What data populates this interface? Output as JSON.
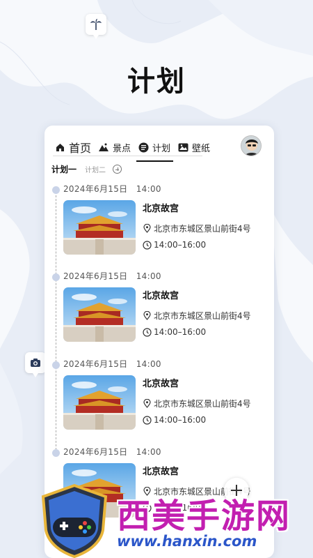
{
  "page": {
    "title": "计划"
  },
  "nav": {
    "tabs": [
      {
        "label": "首页",
        "icon": "home-icon"
      },
      {
        "label": "景点",
        "icon": "mountain-icon"
      },
      {
        "label": "计划",
        "icon": "plan-icon",
        "active": true
      },
      {
        "label": "壁纸",
        "icon": "wallpaper-icon"
      }
    ]
  },
  "plan_tabs": {
    "plan1": "计划一",
    "plan2": "计划二"
  },
  "entries": [
    {
      "datetime": "2024年6月15日　14:00",
      "place": "北京故宫",
      "address": "北京市东城区景山前街4号",
      "time": "14:00–16:00"
    },
    {
      "datetime": "2024年6月15日　14:00",
      "place": "北京故宫",
      "address": "北京市东城区景山前街4号",
      "time": "14:00–16:00"
    },
    {
      "datetime": "2024年6月15日　14:00",
      "place": "北京故宫",
      "address": "北京市东城区景山前街4号",
      "time": "14:00–16:00"
    },
    {
      "datetime": "2024年6月15日　14:00",
      "place": "北京故宫",
      "address": "北京市东城区景山前街4号",
      "time": "14:00–16:00"
    }
  ],
  "watermark": {
    "text": "西美手游网",
    "url": "www.hanxin.com"
  },
  "colors": {
    "accent": "#111111",
    "watermark": "#c21fb0",
    "timeline_dot": "#c9d3e8"
  }
}
